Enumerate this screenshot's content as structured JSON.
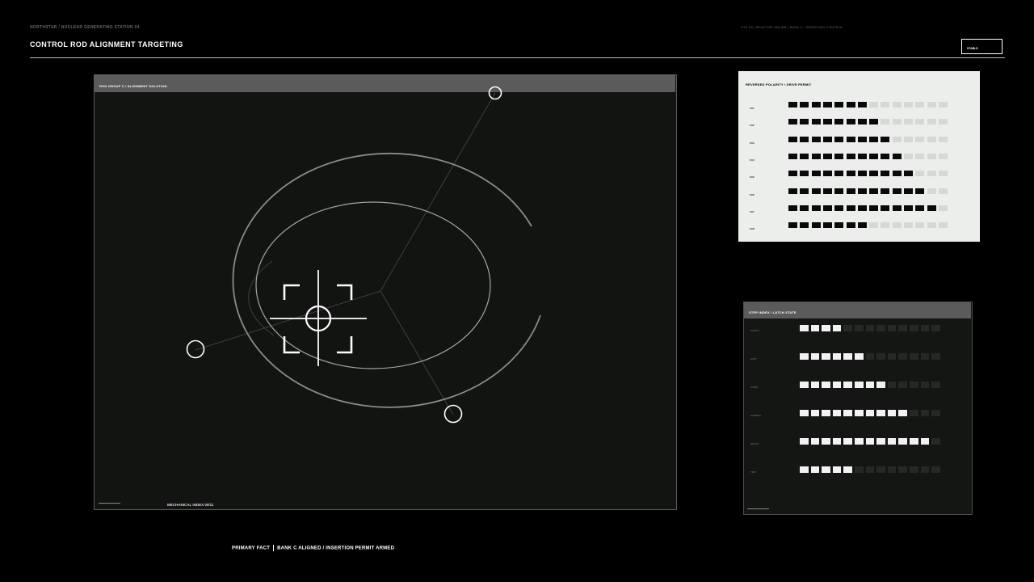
{
  "header": {
    "breadcrumb": "NORTHSTAR / NUCLEAR GENERATING STATION 04",
    "title": "CONTROL ROD ALIGNMENT TARGETING",
    "system_line": "SYS 03 | REACTOR ONLINE | BANK C / INSERTION CONTROL",
    "status_badge": "STABLE"
  },
  "alignment_panel": {
    "title": "ROD GROUP C / ALIGNMENT SOLUTION",
    "mechanical_index": "MECHANICAL INDEX 00/11"
  },
  "polarity_panel": {
    "title": "REVERSED POLARITY / DRIVE PERMIT",
    "total_segments": 14,
    "rows": [
      {
        "label": "C01",
        "filled": 7
      },
      {
        "label": "C02",
        "filled": 8
      },
      {
        "label": "C03",
        "filled": 9
      },
      {
        "label": "C04",
        "filled": 10
      },
      {
        "label": "C05",
        "filled": 11
      },
      {
        "label": "C06",
        "filled": 12
      },
      {
        "label": "C07",
        "filled": 13
      },
      {
        "label": "C08",
        "filled": 7
      }
    ]
  },
  "step_panel": {
    "title": "STEP INDEX / LATCH STATE",
    "total_segments": 13,
    "rows": [
      {
        "label": "NORTH",
        "filled": 4
      },
      {
        "label": "EAST",
        "filled": 6
      },
      {
        "label": "CORE",
        "filled": 8
      },
      {
        "label": "HARBOR",
        "filled": 10
      },
      {
        "label": "BRAVO",
        "filled": 12
      },
      {
        "label": "TRIP",
        "filled": 5
      }
    ]
  },
  "footer": {
    "primary_label": "PRIMARY FACT",
    "primary_text": "BANK C ALIGNED / INSERTION PERMIT ARMED"
  },
  "icons": {
    "reticle": "crosshair-reticle-icon",
    "node": "circle-node-icon"
  },
  "colors": {
    "background": "#000000",
    "panel_dark": "#121412",
    "panel_light": "#eceeec",
    "header_bar": "#5a5b5a",
    "accent": "#ffffff"
  }
}
